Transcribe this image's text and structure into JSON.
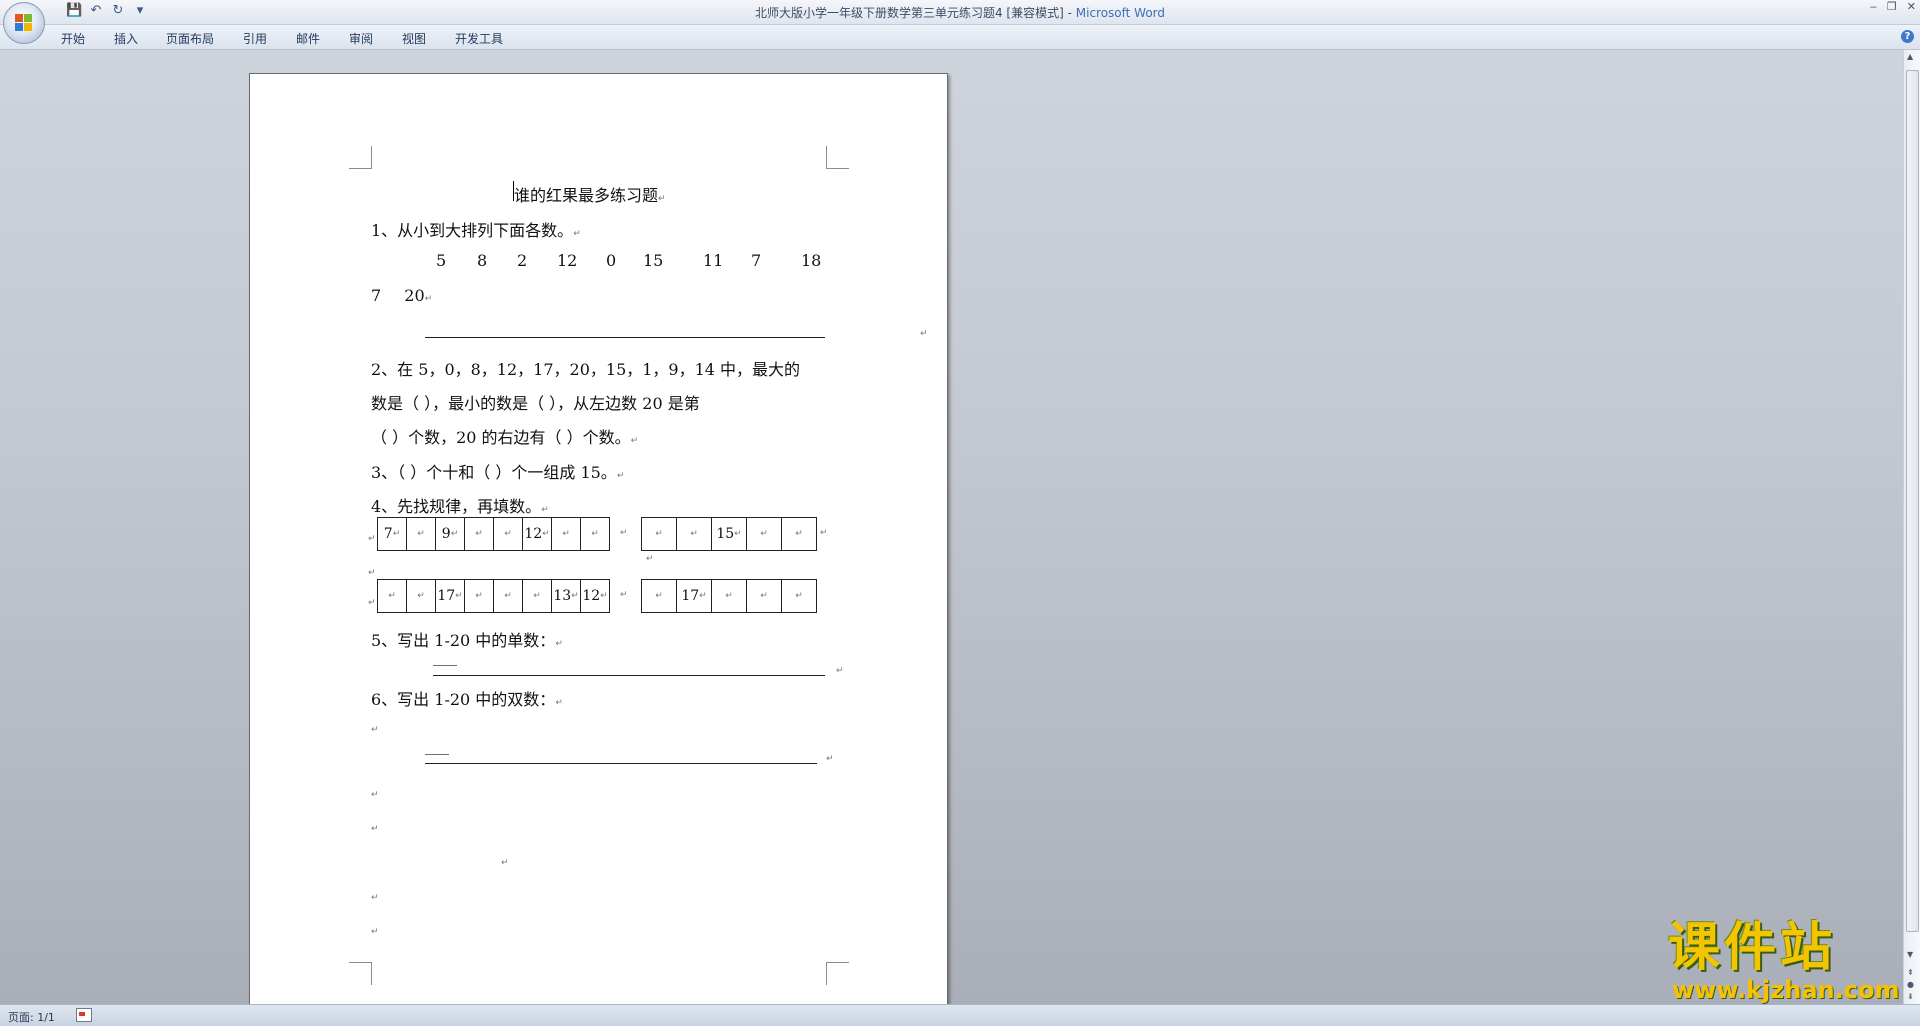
{
  "window": {
    "doc_title": "北师大版小学一年级下册数学第三单元练习题4 [兼容模式]",
    "app_sep": " - ",
    "app_name": "Microsoft Word",
    "controls": [
      "‒",
      "❐",
      "✕"
    ]
  },
  "quick_access": [
    "save-icon",
    "undo-icon",
    "redo-icon",
    "customize-icon"
  ],
  "ribbon": {
    "tabs": [
      "开始",
      "插入",
      "页面布局",
      "引用",
      "邮件",
      "审阅",
      "视图",
      "开发工具"
    ],
    "help_label": "?"
  },
  "document": {
    "title": "谁的红果最多练习题",
    "q1": "1、从小到大排列下面各数。",
    "q1_numbers": [
      "5",
      "8",
      "2",
      "12",
      "0",
      "15",
      "11",
      "7",
      "18"
    ],
    "q1_numbers2": [
      "7",
      "20"
    ],
    "q2_line1": "2、在 5，0，8，12，17，20，15，1，9，14 中，最大的",
    "q2_line2": "数是（      ），最小的数是（       ），从左边数 20 是第",
    "q2_line3": "（      ）个数，20 的右边有（    ）个数。",
    "q3": "3、（       ）个十和（       ）个一组成 15。",
    "q4": "4、先找规律，再填数。",
    "grid1": [
      "7",
      "",
      "9",
      "",
      "",
      "12",
      "",
      ""
    ],
    "grid2": [
      "",
      "",
      "15",
      "",
      ""
    ],
    "grid3": [
      "",
      "",
      "17",
      "",
      "",
      "",
      "13",
      "12"
    ],
    "grid4": [
      "",
      "17",
      "",
      "",
      ""
    ],
    "q5": "5、写出 1-20 中的单数：",
    "q5_blank": "___",
    "q6": "6、写出 1-20 中的双数：",
    "q6_blank": "___",
    "para_mark": "↵"
  },
  "status": {
    "page": "页面: 1/1"
  },
  "watermark": {
    "text": "课件站",
    "url": "www.kjzhan.com"
  }
}
